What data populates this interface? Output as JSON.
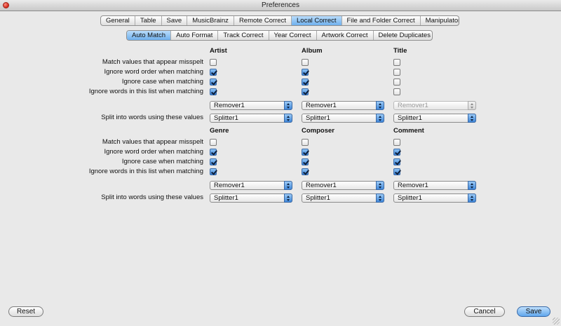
{
  "window": {
    "title": "Preferences"
  },
  "main_tabs": [
    "General",
    "Table",
    "Save",
    "MusicBrainz",
    "Remote Correct",
    "Local Correct",
    "File and Folder Correct",
    "Manipulators"
  ],
  "main_tab_active": "Local Correct",
  "sub_tabs": [
    "Auto Match",
    "Auto Format",
    "Track Correct",
    "Year Correct",
    "Artwork Correct",
    "Delete Duplicates"
  ],
  "sub_tab_active": "Auto Match",
  "row_labels": {
    "misspelt": "Match values that appear misspelt",
    "word_order": "Ignore word order when matching",
    "case": "Ignore case when matching",
    "words_list": "Ignore words in this list when matching",
    "split": "Split into words using these values"
  },
  "groups": [
    {
      "columns": [
        {
          "header": "Artist",
          "misspelt": false,
          "word_order": true,
          "case": true,
          "words_list": true,
          "remover": "Remover1",
          "remover_disabled": false,
          "splitter": "Splitter1"
        },
        {
          "header": "Album",
          "misspelt": false,
          "word_order": true,
          "case": true,
          "words_list": true,
          "remover": "Remover1",
          "remover_disabled": false,
          "splitter": "Splitter1"
        },
        {
          "header": "Title",
          "misspelt": false,
          "word_order": false,
          "case": false,
          "words_list": false,
          "remover": "Remover1",
          "remover_disabled": true,
          "splitter": "Splitter1"
        }
      ]
    },
    {
      "columns": [
        {
          "header": "Genre",
          "misspelt": false,
          "word_order": true,
          "case": true,
          "words_list": true,
          "remover": "Remover1",
          "remover_disabled": false,
          "splitter": "Splitter1"
        },
        {
          "header": "Composer",
          "misspelt": false,
          "word_order": true,
          "case": true,
          "words_list": true,
          "remover": "Remover1",
          "remover_disabled": false,
          "splitter": "Splitter1"
        },
        {
          "header": "Comment",
          "misspelt": false,
          "word_order": true,
          "case": true,
          "words_list": true,
          "remover": "Remover1",
          "remover_disabled": false,
          "splitter": "Splitter1"
        }
      ]
    }
  ],
  "buttons": {
    "reset": "Reset",
    "cancel": "Cancel",
    "save": "Save"
  },
  "colors": {
    "accent": "#5fa6ec",
    "background": "#e9e9e9"
  }
}
